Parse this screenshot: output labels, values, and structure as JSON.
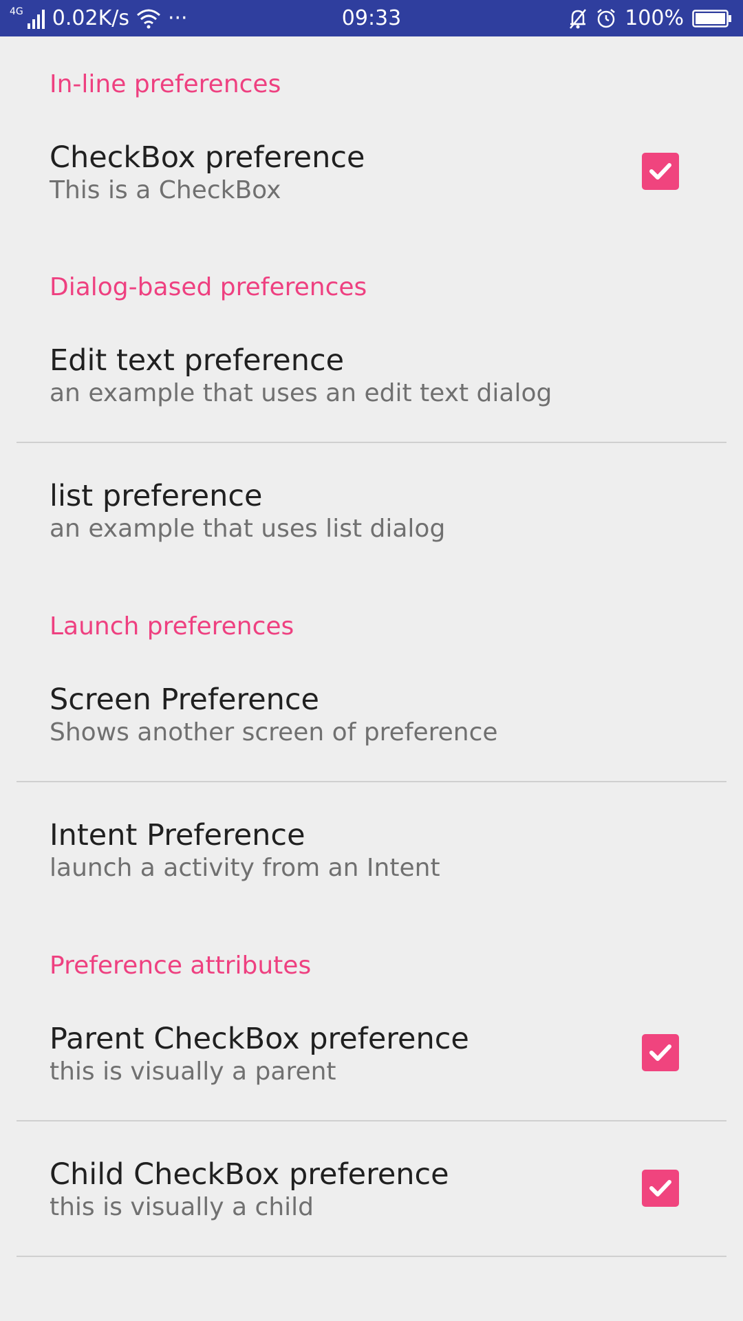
{
  "status_bar": {
    "network_type": "4G",
    "speed": "0.02K/s",
    "more": "···",
    "time": "09:33",
    "battery": "100%",
    "color": "#2f3e9e"
  },
  "accent_color": "#ee4080",
  "sections": {
    "inline": {
      "header": "In-line preferences",
      "checkbox_pref": {
        "title": "CheckBox preference",
        "summary": "This is a CheckBox",
        "checked": true
      }
    },
    "dialog": {
      "header": "Dialog-based preferences",
      "edit_text": {
        "title": "Edit text preference",
        "summary": "an example that uses an edit text dialog"
      },
      "list": {
        "title": "list preference",
        "summary": "an example that uses list dialog"
      }
    },
    "launch": {
      "header": "Launch preferences",
      "screen": {
        "title": "Screen Preference",
        "summary": "Shows another screen of preference"
      },
      "intent": {
        "title": "Intent Preference",
        "summary": "launch a activity from an Intent"
      }
    },
    "attributes": {
      "header": "Preference attributes",
      "parent": {
        "title": "Parent CheckBox preference",
        "summary": "this is visually a parent",
        "checked": true
      },
      "child": {
        "title": "Child CheckBox preference",
        "summary": "this is visually a child",
        "checked": true
      }
    }
  }
}
